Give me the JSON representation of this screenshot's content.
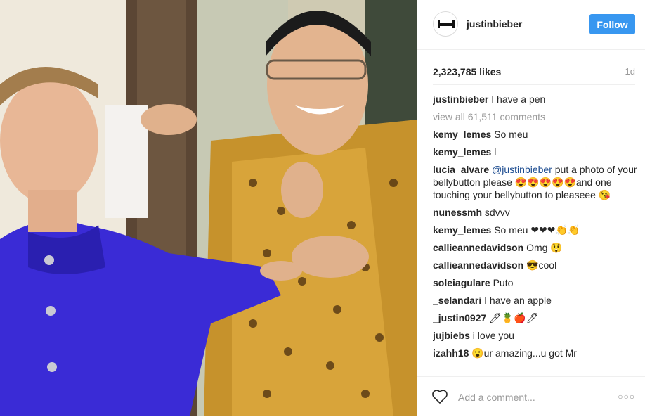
{
  "post": {
    "username": "justinbieber",
    "follow_label": "Follow",
    "likes": "2,323,785 likes",
    "time": "1d",
    "view_all": "view all 61,511 comments",
    "comments": [
      {
        "user": "justinbieber",
        "text": "I have a pen"
      },
      {
        "user": "kemy_lemes",
        "text": "So meu"
      },
      {
        "user": "kemy_lemes",
        "text": "l"
      },
      {
        "user": "lucia_alvare",
        "mention": "@justinbieber",
        "text": "put a photo of your bellybutton please 😍😍😍😍😍and one touching your bellybutton to pleaseee 😘"
      },
      {
        "user": "nunessmh",
        "text": "sdvvv"
      },
      {
        "user": "kemy_lemes",
        "text": "So meu ❤❤❤👏👏"
      },
      {
        "user": "callieannedavidson",
        "text": "Omg 😲"
      },
      {
        "user": "callieannedavidson",
        "text": "😎cool"
      },
      {
        "user": "soleiagulare",
        "text": "Puto"
      },
      {
        "user": "_selandari",
        "text": "I have an apple"
      },
      {
        "user": "_justin0927",
        "text": "🖊🍍🍎🖊"
      },
      {
        "user": "jujbiebs",
        "text": "i love you"
      },
      {
        "user": "izahh18",
        "text": "😮ur amazing...u got Mr"
      }
    ],
    "add_comment_placeholder": "Add a comment...",
    "more_icon": "more-options-icon",
    "accent_color": "#3897f0"
  }
}
